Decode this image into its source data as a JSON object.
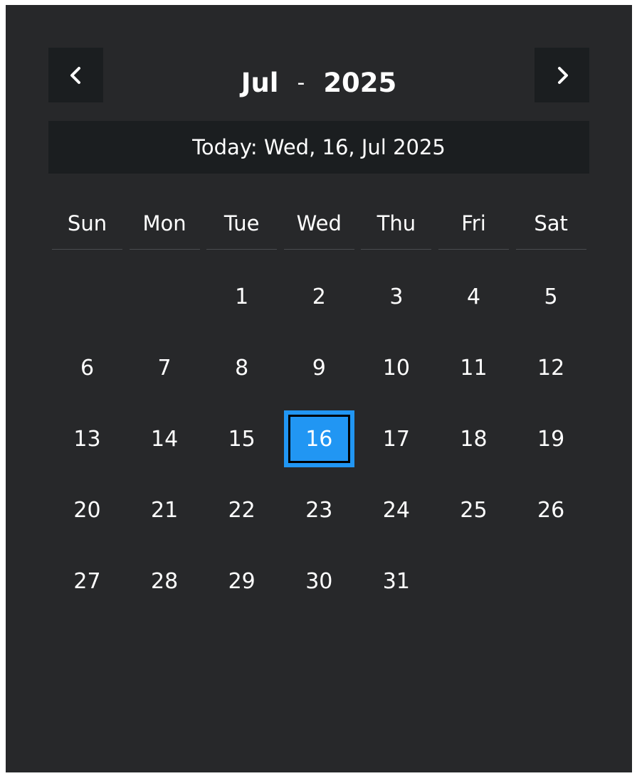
{
  "calendar": {
    "month": "Jul",
    "separator": "-",
    "year": "2025",
    "today_label": "Today: Wed, 16, Jul 2025",
    "weekdays": [
      "Sun",
      "Mon",
      "Tue",
      "Wed",
      "Thu",
      "Fri",
      "Sat"
    ],
    "first_weekday_index": 2,
    "days": [
      "1",
      "2",
      "3",
      "4",
      "5",
      "6",
      "7",
      "8",
      "9",
      "10",
      "11",
      "12",
      "13",
      "14",
      "15",
      "16",
      "17",
      "18",
      "19",
      "20",
      "21",
      "22",
      "23",
      "24",
      "25",
      "26",
      "27",
      "28",
      "29",
      "30",
      "31"
    ],
    "selected_day": "16",
    "prev_icon": "chevron-left-icon",
    "next_icon": "chevron-right-icon",
    "colors": {
      "background": "#27282a",
      "bar": "#1b1e20",
      "selected": "#2196f3"
    }
  }
}
